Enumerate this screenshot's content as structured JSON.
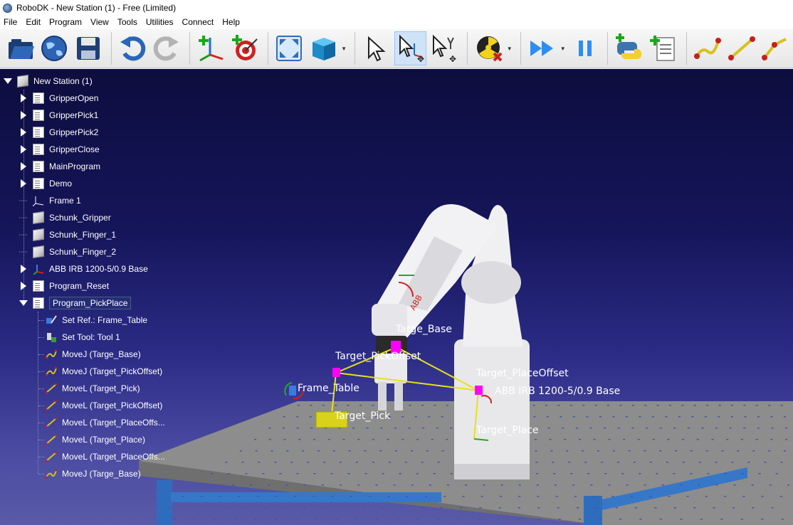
{
  "window": {
    "title": "RoboDK - New Station (1) - Free (Limited)"
  },
  "menu": [
    "File",
    "Edit",
    "Program",
    "View",
    "Tools",
    "Utilities",
    "Connect",
    "Help"
  ],
  "toolbar": {
    "buttons": [
      {
        "icon": "open-folder-icon"
      },
      {
        "icon": "globe-icon"
      },
      {
        "icon": "save-icon"
      },
      {
        "icon": "undo-icon"
      },
      {
        "icon": "redo-icon"
      },
      {
        "icon": "add-frame-icon"
      },
      {
        "icon": "add-target-icon"
      },
      {
        "icon": "fit-all-icon"
      },
      {
        "icon": "cube-view-icon"
      },
      {
        "icon": "select-pointer-icon"
      },
      {
        "icon": "move-reference-icon"
      },
      {
        "icon": "move-tool-icon"
      },
      {
        "icon": "collision-check-icon"
      },
      {
        "icon": "fast-simulation-icon"
      },
      {
        "icon": "pause-icon"
      },
      {
        "icon": "python-icon"
      },
      {
        "icon": "add-program-icon"
      },
      {
        "icon": "joint-move-icon"
      },
      {
        "icon": "linear-move-icon"
      },
      {
        "icon": "circular-move-icon"
      }
    ]
  },
  "tree": {
    "root": "New Station (1)",
    "items": [
      {
        "label": "GripperOpen",
        "type": "program",
        "expandable": true
      },
      {
        "label": "GripperPick1",
        "type": "program",
        "expandable": true
      },
      {
        "label": "GripperPick2",
        "type": "program",
        "expandable": true
      },
      {
        "label": "GripperClose",
        "type": "program",
        "expandable": true
      },
      {
        "label": "MainProgram",
        "type": "program",
        "expandable": true
      },
      {
        "label": "Demo",
        "type": "program",
        "expandable": true
      },
      {
        "label": "Frame 1",
        "type": "frame",
        "expandable": false
      },
      {
        "label": "Schunk_Gripper",
        "type": "object",
        "expandable": false
      },
      {
        "label": "Schunk_Finger_1",
        "type": "object",
        "expandable": false
      },
      {
        "label": "Schunk_Finger_2",
        "type": "object",
        "expandable": false
      },
      {
        "label": "ABB IRB 1200-5/0.9 Base",
        "type": "robot-frame",
        "expandable": true
      },
      {
        "label": "Program_Reset",
        "type": "program",
        "expandable": true
      },
      {
        "label": "Program_PickPlace",
        "type": "program",
        "expandable": true,
        "expanded": true,
        "selected": true
      }
    ],
    "program_instructions": [
      {
        "label": "Set Ref.: Frame_Table",
        "icon": "set-reference-icon"
      },
      {
        "label": "Set Tool: Tool 1",
        "icon": "set-tool-icon"
      },
      {
        "label": "MoveJ (Targe_Base)",
        "icon": "movej-icon"
      },
      {
        "label": "MoveJ (Target_PickOffset)",
        "icon": "movej-icon"
      },
      {
        "label": "MoveL (Target_Pick)",
        "icon": "movel-icon"
      },
      {
        "label": "MoveL (Target_PickOffset)",
        "icon": "movel-icon"
      },
      {
        "label": "MoveL (Target_PlaceOffs...",
        "icon": "movel-icon"
      },
      {
        "label": "MoveL (Target_Place)",
        "icon": "movel-icon"
      },
      {
        "label": "MoveL (Target_PlaceOffs...",
        "icon": "movel-icon"
      },
      {
        "label": "MoveJ (Targe_Base)",
        "icon": "movej-icon"
      }
    ]
  },
  "scene": {
    "labels": {
      "targe_base": "Targe_Base",
      "target_pickoffset": "Target_PickOffset",
      "target_placeoffset": "Target_PlaceOffset",
      "frame_table": "Frame_Table",
      "robot_base": "ABB IRB 1200-5/0.9 Base",
      "target_pick": "Target_Pick",
      "target_place": "Target_Place"
    },
    "colors": {
      "path_line": "#e8e01a",
      "target_marker": "#ff00ff",
      "part": "#d8d21a",
      "table_top": "#8c8c8c",
      "table_frame": "#2f6fc0"
    }
  }
}
